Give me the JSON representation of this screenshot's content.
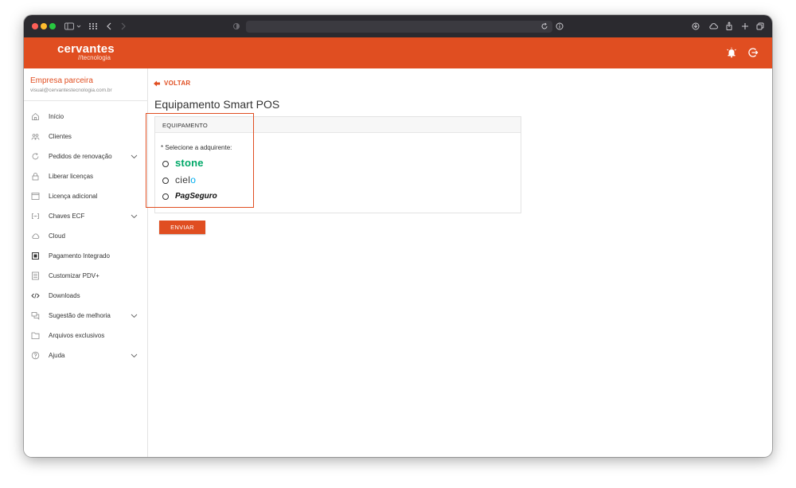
{
  "header": {
    "logo_main": "cervantes",
    "logo_sub": "//tecnologia",
    "accent_color": "#e04e21",
    "icons": [
      "alarm-bell-icon",
      "logout-icon"
    ]
  },
  "sidebar": {
    "company": "Empresa parceira",
    "email": "visual@cervantestecnologia.com.br",
    "items": [
      {
        "label": "Início",
        "icon": "home-icon"
      },
      {
        "label": "Clientes",
        "icon": "users-icon"
      },
      {
        "label": "Pedidos de renovação",
        "icon": "refresh-icon"
      },
      {
        "label": "Liberar licenças",
        "icon": "lock-icon"
      },
      {
        "label": "Licença adicional",
        "icon": "window-icon"
      },
      {
        "label": "Chaves ECF",
        "icon": "key-code-icon"
      },
      {
        "label": "Cloud",
        "icon": "cloud-icon"
      },
      {
        "label": "Pagamento Integrado",
        "icon": "chip-icon"
      },
      {
        "label": "Customizar PDV+",
        "icon": "document-icon"
      },
      {
        "label": "Downloads",
        "icon": "code-icon"
      },
      {
        "label": "Sugestão de melhoria",
        "icon": "comments-icon"
      },
      {
        "label": "Arquivos exclusivos",
        "icon": "folder-icon"
      },
      {
        "label": "Ajuda",
        "icon": "help-icon"
      }
    ]
  },
  "main": {
    "back_label": "VOLTAR",
    "title": "Equipamento Smart POS",
    "panel_title": "EQUIPAMENTO",
    "field_label": "* Selecione a adquirente:",
    "options": {
      "stone": "stone",
      "cielo_base": "ciel",
      "cielo_o": "o",
      "pagseguro": "PagSeguro"
    },
    "submit_label": "ENVIAR"
  }
}
